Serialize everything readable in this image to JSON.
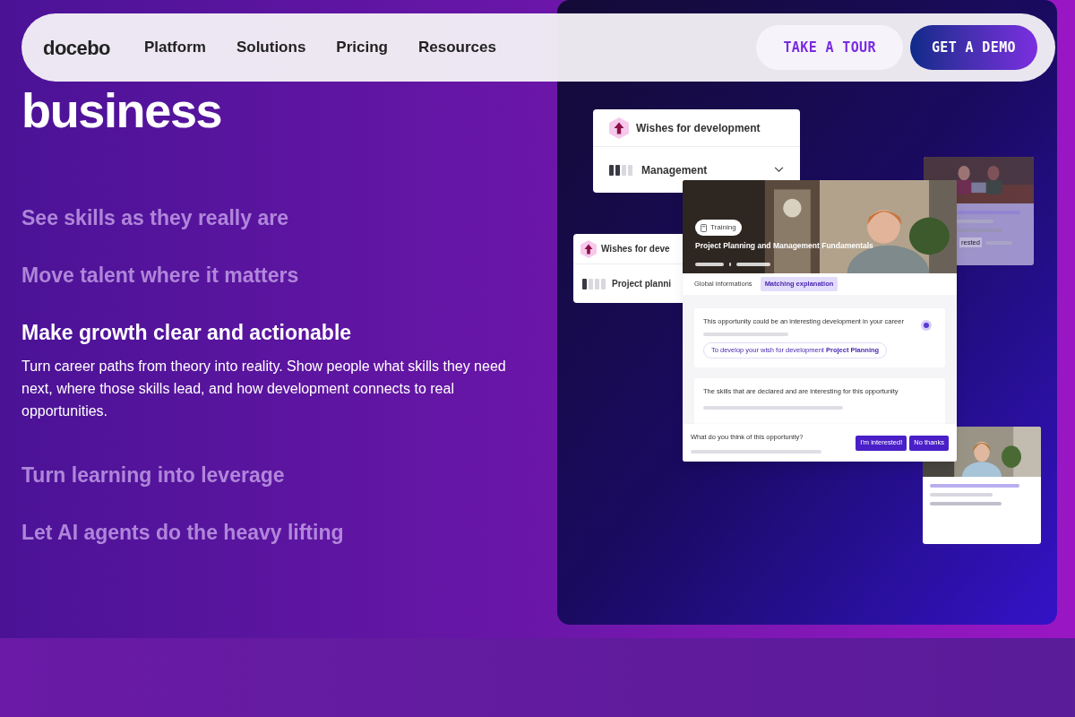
{
  "nav": {
    "logo": "docebo",
    "links": [
      "Platform",
      "Solutions",
      "Pricing",
      "Resources"
    ],
    "tour_button": "TAKE A TOUR",
    "demo_button": "GET A DEMO"
  },
  "headline": "business",
  "features": [
    {
      "title": "See skills as they really are",
      "selected": false
    },
    {
      "title": "Move talent where it matters",
      "selected": false
    },
    {
      "title": "Make growth clear and actionable",
      "selected": true,
      "description": "Turn career paths from theory into reality. Show people what skills they need next, where those skills lead, and how development connects to real opportunities."
    },
    {
      "title": "Turn learning into leverage",
      "selected": false
    },
    {
      "title": "Let AI agents do the heavy lifting",
      "selected": false
    }
  ],
  "mockup": {
    "wish_cards": [
      {
        "title": "Wishes for development",
        "skill": "Management",
        "level": 0.5,
        "expandable": true
      },
      {
        "title": "Wishes for deve",
        "skill": "Project planni",
        "level": 0.25
      }
    ],
    "opportunity": {
      "tag": "Training",
      "title": "Project Planning and Management Fundamentals",
      "tabs": [
        {
          "label": "Global informations",
          "selected": false
        },
        {
          "label": "Matching explanation",
          "selected": true
        }
      ],
      "match_text": "This opportunity could be an interesting development in your career",
      "match_chip": "To develop your wish for development **Project Planning**",
      "skills_text": "The skills that are declared and are interesting for this opportunity",
      "question": "What do you think of this opportunity?",
      "buttons": [
        "I'm interested!",
        "No thanks"
      ]
    },
    "side_cards": [
      {
        "kind": "picture",
        "peek_text": "rested"
      },
      {
        "kind": "picture"
      }
    ]
  }
}
